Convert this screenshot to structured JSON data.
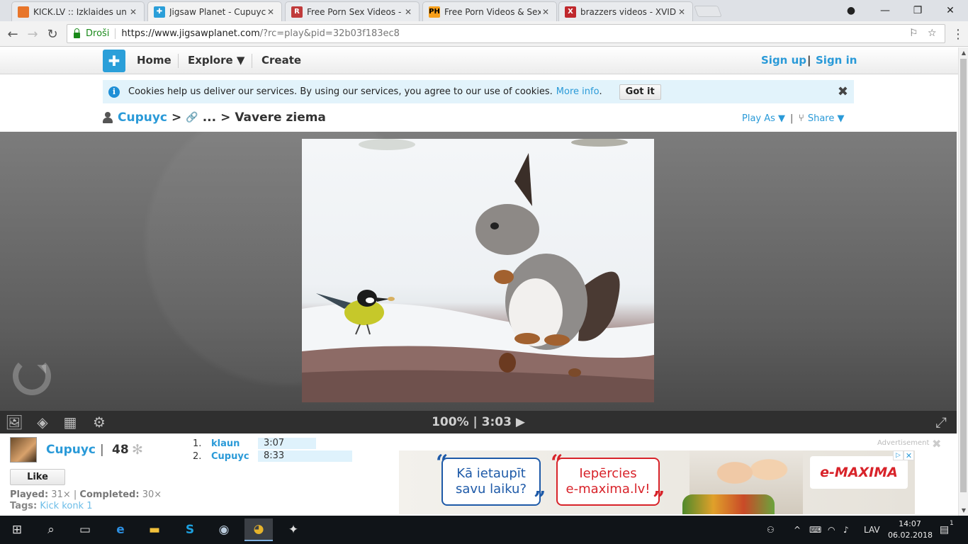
{
  "browser": {
    "tabs": [
      {
        "title": "KICK.LV :: Izklaides un spē",
        "favicon_text": "",
        "favicon_color": "#e8752a"
      },
      {
        "title": "Jigsaw Planet - Cupuyc -",
        "favicon_text": "✚",
        "favicon_color": "#2b9fd9"
      },
      {
        "title": "Free Porn Sex Videos - R",
        "favicon_text": "R",
        "favicon_color": "#c03b3b"
      },
      {
        "title": "Free Porn Videos & Sex M",
        "favicon_text": "PH",
        "favicon_color": "#f79f1b"
      },
      {
        "title": "brazzers videos - XVIDEO",
        "favicon_text": "X",
        "favicon_color": "#c0282d"
      }
    ],
    "secure_label": "Droši",
    "url_main": "https://www.jigsawplanet.com",
    "url_rest": "/?rc=play&pid=32b03f183ec8"
  },
  "site": {
    "nav": {
      "home": "Home",
      "explore": "Explore ▼",
      "create": "Create"
    },
    "auth": {
      "signup": "Sign up",
      "sep": "|",
      "signin": "Sign in"
    }
  },
  "cookie": {
    "text": "Cookies help us deliver our services. By using our services, you agree to our use of cookies.",
    "more": "More info",
    "period": ".",
    "button": "Got it"
  },
  "breadcrumb": {
    "owner": "Cupuyc",
    "sep": ">",
    "middle": "...",
    "title": "Vavere ziema"
  },
  "options": {
    "play_as": "Play As ▼",
    "bar": "|",
    "share": "Share ▼"
  },
  "controls": {
    "progress_text": "100% | 3:03 ▶"
  },
  "user": {
    "name": "Cupuyc",
    "sep": "|",
    "pieces": "48",
    "like": "Like",
    "played_label": "Played:",
    "played_value": "31×",
    "completed_label": "Completed:",
    "completed_value": "30×",
    "stats_sep": "|",
    "tags_label": "Tags:",
    "tags_value": "Kick konk 1"
  },
  "scores": [
    {
      "rank": "1.",
      "name": "klaun",
      "time": "3:07",
      "bar_fraction": 0.4
    },
    {
      "rank": "2.",
      "name": "Cupuyc",
      "time": "8:33",
      "bar_fraction": 1.0
    }
  ],
  "ad": {
    "label": "Advertisement",
    "bubble1_line1": "Kā ietaupīt",
    "bubble1_line2": "savu laiku?",
    "bubble2_line1": "Iepērcies",
    "bubble2_line2": "e-maxima.lv!",
    "brand": "e-MAXIMA"
  },
  "taskbar": {
    "language": "LAV",
    "time": "14:07",
    "date": "06.02.2018",
    "notifications": "1"
  }
}
